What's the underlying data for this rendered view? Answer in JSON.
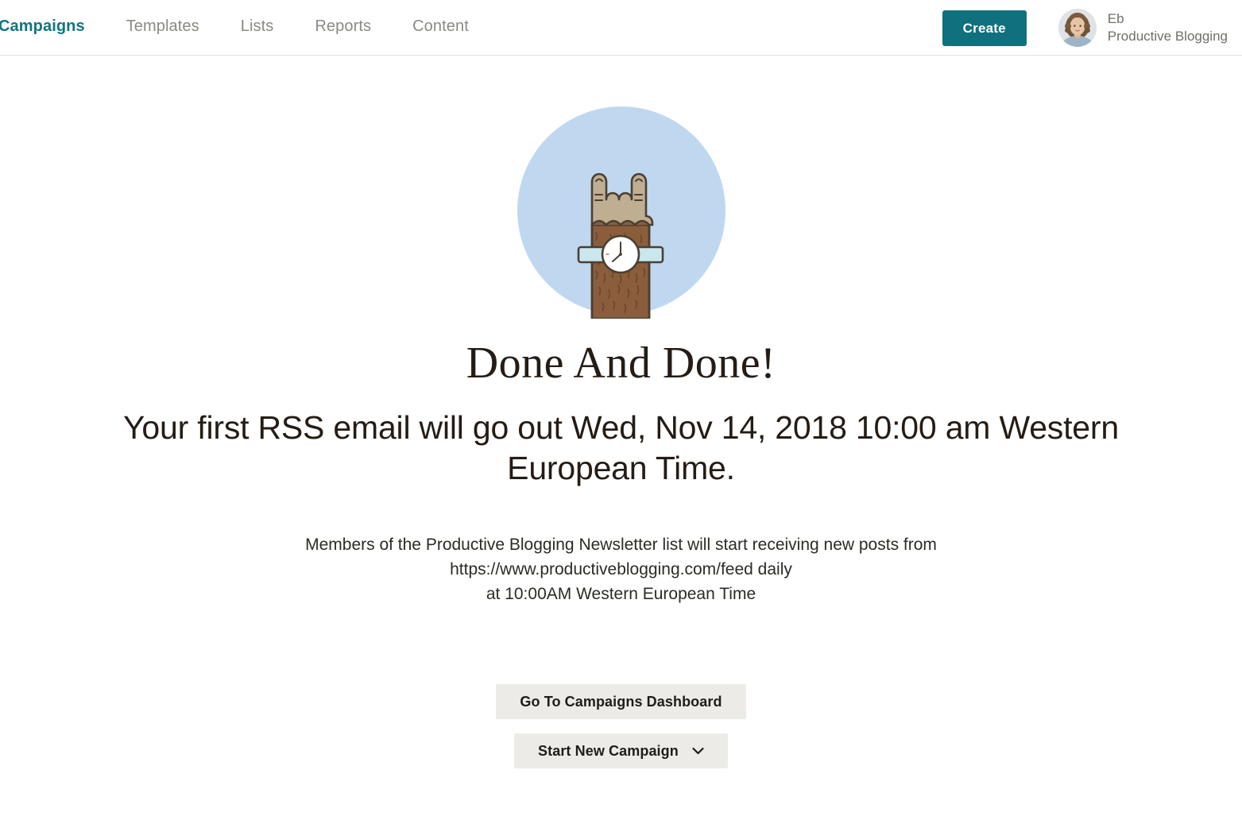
{
  "header": {
    "nav": [
      {
        "label": "Campaigns",
        "active": true,
        "clipped": true
      },
      {
        "label": "Templates",
        "active": false
      },
      {
        "label": "Lists",
        "active": false
      },
      {
        "label": "Reports",
        "active": false
      },
      {
        "label": "Content",
        "active": false
      }
    ],
    "create_label": "Create",
    "account": {
      "name": "Eb",
      "org": "Productive Blogging",
      "avatar_alt": "user-avatar-photo"
    },
    "accent_color": "#10707e",
    "nav_inactive_color": "#8a8a84",
    "border_color": "#e0e0dc"
  },
  "illustration": {
    "name": "rock-on-hand-with-watch",
    "circle_color": "#c0d8ef",
    "hand_color": "#bfae91",
    "arm_color": "#8a5e3c",
    "hair_color": "#6d4527",
    "watch_band_color": "#c9e7ed",
    "watch_face_color": "#ffffff",
    "outline_color": "#4a3f33"
  },
  "main": {
    "headline": "Done And Done!",
    "subheadline": "Your first RSS email will go out Wed, Nov 14, 2018 10:00 am Western European Time.",
    "body_lines": [
      "Members of the Productive Blogging Newsletter list will start receiving new posts from",
      "https://www.productiveblogging.com/feed daily",
      "at 10:00AM Western European Time"
    ],
    "buttons": {
      "dashboard_label": "Go To Campaigns Dashboard",
      "new_campaign_label": "Start New Campaign",
      "new_campaign_caret": "⌄"
    },
    "button_bg": "#ecebe7"
  }
}
